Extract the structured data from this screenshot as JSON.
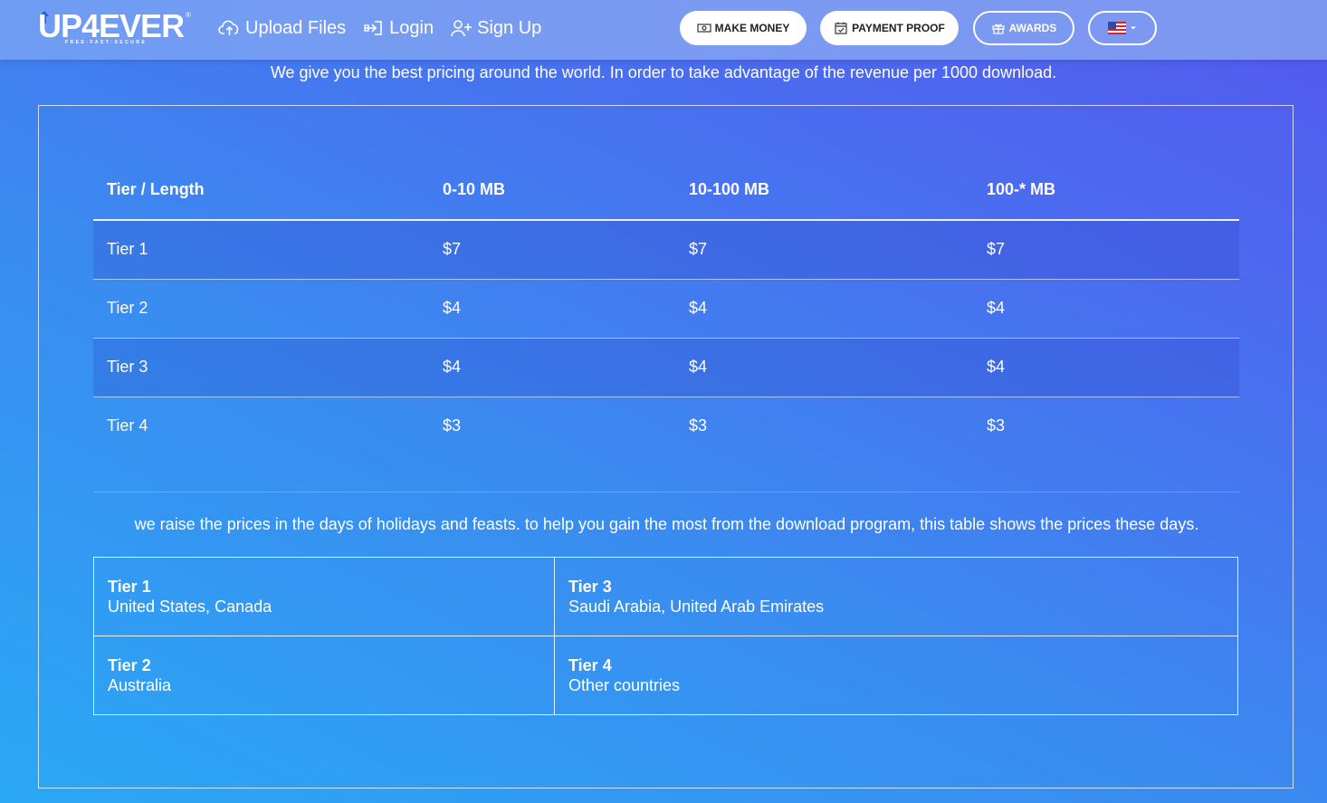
{
  "header": {
    "logo": {
      "text": "UP4EVER",
      "tagline": "FREE·FAST·SECURE",
      "reg": "®"
    },
    "nav": [
      {
        "label": "Upload Files",
        "icon": "cloud-upload-icon"
      },
      {
        "label": "Login",
        "icon": "login-icon"
      },
      {
        "label": "Sign Up",
        "icon": "user-plus-icon"
      }
    ],
    "buttons": {
      "make_money": "MAKE MONEY",
      "payment_proof": "PAYMENT PROOF",
      "awards": "AWARDS"
    },
    "language": {
      "icon": "us-flag-icon"
    }
  },
  "intro": "We give you the best pricing around the world. In order to take advantage of the revenue per 1000 download.",
  "pricing": {
    "columns": [
      "Tier / Length",
      "0-10 MB",
      "10-100 MB",
      "100-* MB"
    ],
    "rows": [
      [
        "Tier 1",
        "$7",
        "$7",
        "$7"
      ],
      [
        "Tier 2",
        "$4",
        "$4",
        "$4"
      ],
      [
        "Tier 3",
        "$4",
        "$4",
        "$4"
      ],
      [
        "Tier 4",
        "$3",
        "$3",
        "$3"
      ]
    ]
  },
  "note": "we raise the prices in the days of holidays and feasts. to help you gain the most from the download program, this table shows the prices these days.",
  "regions": [
    {
      "tier": "Tier 1",
      "countries": "United States, Canada"
    },
    {
      "tier": "Tier 3",
      "countries": "Saudi Arabia, United Arab Emirates"
    },
    {
      "tier": "Tier 2",
      "countries": "Australia"
    },
    {
      "tier": "Tier 4",
      "countries": "Other countries"
    }
  ],
  "colors": {
    "accent": "#ffffff",
    "bg_start": "#2aa8f5",
    "bg_end": "#5458ee"
  }
}
